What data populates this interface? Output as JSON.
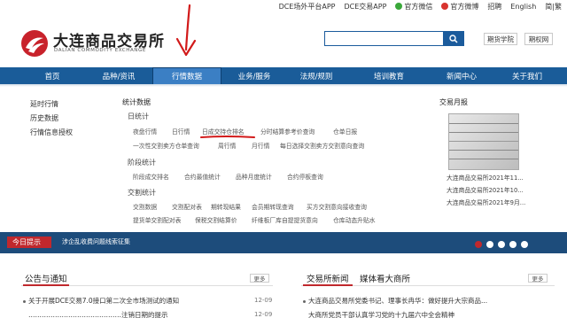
{
  "topbar": {
    "links": [
      {
        "label": "DCE场外平台APP",
        "icon": ""
      },
      {
        "label": "DCE交易APP",
        "icon": ""
      },
      {
        "label": "官方微信",
        "icon": "wechat-icon",
        "color": "#3aa83a"
      },
      {
        "label": "官方微博",
        "icon": "weibo-icon",
        "color": "#d8342f"
      },
      {
        "label": "招聘",
        "icon": ""
      },
      {
        "label": "English",
        "icon": ""
      },
      {
        "label": "简|繁",
        "icon": ""
      }
    ]
  },
  "header": {
    "logo_cn": "大连商品交易所",
    "logo_en": "DALIAN COMMODITY EXCHANGE",
    "search_placeholder": "",
    "btn_school": "期货学院",
    "btn_rights": "期权网"
  },
  "nav": {
    "items": [
      "首页",
      "品种/资讯",
      "行情数据",
      "业务/服务",
      "法规/规则",
      "培训教育",
      "新闻中心",
      "关于我们"
    ],
    "active_index": 2
  },
  "menu": {
    "left_items": [
      "延时行情",
      "历史数据",
      "行情信息授权"
    ],
    "stats_title": "统计数据",
    "daily_title": "日统计",
    "daily_row1": [
      "夜盘行情",
      "日行情",
      "日成交持仓排名",
      "分时结算参考价查询",
      "仓单日报"
    ],
    "daily_row2": [
      "一次性交割卖方仓单查询",
      "周行情",
      "月行情",
      "每日选择交割卖方交割意向查询"
    ],
    "phase_title": "阶段统计",
    "phase_row": [
      "阶段成交排名",
      "合约最值统计",
      "品种月度统计",
      "合约停板查询"
    ],
    "trade_title": "交割统计",
    "trade_row1": [
      "交割数据",
      "交割配对表",
      "期转现结果",
      "会员期转现查询",
      "买方交割意向接收查询"
    ],
    "trade_row2": [
      "提货单交割配对表",
      "保税交割结算价",
      "纤维板厂库自提提货意向",
      "仓库动态升贴水"
    ]
  },
  "report": {
    "title": "交易月报",
    "items": [
      "大连商品交易所2021年11...",
      "大连商品交易所2021年10...",
      "大连商品交易所2021年9月..."
    ]
  },
  "tip": {
    "label": "今日提示",
    "message": "涉企乱收费问题线索征集"
  },
  "notice": {
    "title": "公告与通知",
    "more": "更多",
    "items": [
      {
        "text": "关于开展DCE交易7.0接口第二次全市场测试的通知",
        "date": "12-09"
      },
      {
        "text": "……………………………………注销日期的提示",
        "date": "12-09"
      }
    ]
  },
  "news": {
    "tab1": "交易所新闻",
    "tab2": "媒体看大商所",
    "more": "更多",
    "items": [
      "大连商品交易所党委书记、理事长冉华：做好提升大宗商品...",
      "大商所党员干部认真学习党的十九届六中全会精神"
    ]
  }
}
